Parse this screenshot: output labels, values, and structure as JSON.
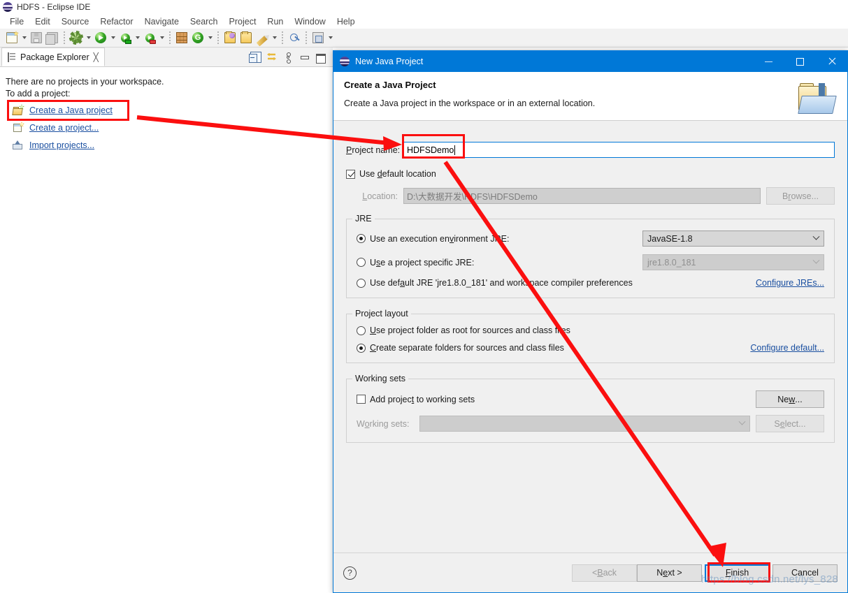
{
  "app": {
    "window_title": "HDFS - Eclipse IDE",
    "menus": [
      "File",
      "Edit",
      "Source",
      "Refactor",
      "Navigate",
      "Search",
      "Project",
      "Run",
      "Window",
      "Help"
    ],
    "toolbar_icons": [
      "new-document-icon",
      "new-document-dropdown",
      "save-icon",
      "save-all-icon",
      "debug-icon",
      "debug-dropdown",
      "run-icon",
      "run-dropdown",
      "run-external-tools-icon",
      "run-external-tools-dropdown",
      "run-ant-icon",
      "run-ant-dropdown",
      "new-java-package-icon",
      "new-java-class-icon",
      "new-java-class-dropdown",
      "open-type-icon",
      "open-task-icon",
      "annotation-icon",
      "annotation-dropdown",
      "skip-breakpoints-icon",
      "previous-annotation-icon",
      "previous-annotation-dropdown"
    ]
  },
  "explorer": {
    "tab_label": "Package Explorer",
    "tab_icon": "package-explorer-icon",
    "tab_close": "╳",
    "toolbar_icons": [
      "collapse-all-icon",
      "link-with-editor-icon",
      "view-menu-icon",
      "minimize-icon",
      "maximize-icon"
    ],
    "empty_line_1": "There are no projects in your workspace.",
    "empty_line_2": "To add a project:",
    "links": [
      {
        "label": "Create a Java project",
        "icon": "new-java-project-icon"
      },
      {
        "label": "Create a project...",
        "icon": "new-project-icon"
      },
      {
        "label": "Import projects...",
        "icon": "import-projects-icon"
      }
    ]
  },
  "dialog": {
    "title": "New Java Project",
    "title_icon": "eclipse-icon",
    "window_controls": [
      "minimize",
      "maximize",
      "close"
    ],
    "header_title": "Create a Java Project",
    "header_subtitle": "Create a Java project in the workspace or in an external location.",
    "header_icon": "new-java-project-banner-icon",
    "project_name": {
      "label_pre": "P",
      "label_key": "r",
      "label_post": "oject name:",
      "label_full": "Project name:",
      "value": "HDFSDemo"
    },
    "use_default_location": {
      "label_pre": "Use ",
      "label_key": "d",
      "label_post": "efault location",
      "label_full": "Use default location",
      "checked": true
    },
    "location": {
      "label_pre": "L",
      "label_key": "o",
      "label_post": "cation:",
      "label_full": "Location:",
      "value": "D:\\大数据开发\\HDFS\\HDFSDemo",
      "enabled": false,
      "browse_label_pre": "B",
      "browse_label_key": "r",
      "browse_label_post": "owse...",
      "browse_label_full": "Browse..."
    },
    "jre": {
      "legend": "JRE",
      "options": [
        {
          "label_pre": "Use an execution en",
          "label_key": "v",
          "label_post": "ironment JRE:",
          "label_full": "Use an execution environment JRE:",
          "selected": true
        },
        {
          "label_pre": "U",
          "label_key": "s",
          "label_post": "e a project specific JRE:",
          "label_full": "Use a project specific JRE:",
          "selected": false
        },
        {
          "label_pre": "Use def",
          "label_key": "a",
          "label_post": "ult JRE 'jre1.8.0_181' and workspace compiler preferences",
          "label_full": "Use default JRE 'jre1.8.0_181' and workspace compiler preferences",
          "selected": false
        }
      ],
      "execution_env_value": "JavaSE-1.8",
      "specific_jre_value": "jre1.8.0_181",
      "configure_link": "Configure JREs..."
    },
    "project_layout": {
      "legend": "Project layout",
      "options": [
        {
          "label_pre": "",
          "label_key": "U",
          "label_post": "se project folder as root for sources and class files",
          "label_full": "Use project folder as root for sources and class files",
          "selected": false
        },
        {
          "label_pre": "",
          "label_key": "C",
          "label_post": "reate separate folders for sources and class files",
          "label_full": "Create separate folders for sources and class files",
          "selected": true
        }
      ],
      "configure_link": "Configure default..."
    },
    "working_sets": {
      "legend": "Working sets",
      "add_checkbox": {
        "label_pre": "Add projec",
        "label_key": "t",
        "label_post": " to working sets",
        "label_full": "Add project to working sets",
        "checked": false
      },
      "list_label_pre": "W",
      "list_label_key": "o",
      "list_label_post": "rking sets:",
      "list_label_full": "Working sets:",
      "list_value": "",
      "new_button_pre": "Ne",
      "new_button_key": "w",
      "new_button_post": "...",
      "new_button_full": "New...",
      "select_button_pre": "S",
      "select_button_key": "e",
      "select_button_post": "lect...",
      "select_button_full": "Select..."
    },
    "footer": {
      "help_icon": "help-icon",
      "back_pre": "< ",
      "back_key": "B",
      "back_post": "ack",
      "back_full": "< Back",
      "back_enabled": false,
      "next_pre": "N",
      "next_key": "e",
      "next_post": "xt >",
      "next_full": "Next >",
      "finish_pre": "",
      "finish_key": "F",
      "finish_post": "inish",
      "finish_full": "Finish",
      "finish_default": true,
      "cancel_full": "Cancel"
    }
  },
  "annotations": {
    "accent_color": "#fb0f0f",
    "highlight_create_java_project": true,
    "highlight_project_name": true,
    "arrow_to_project_name": true,
    "arrow_to_finish": true,
    "highlight_finish": true
  },
  "watermark": {
    "text": "https://blog.csdn.net/lys_828",
    "color": "#5082b9"
  }
}
